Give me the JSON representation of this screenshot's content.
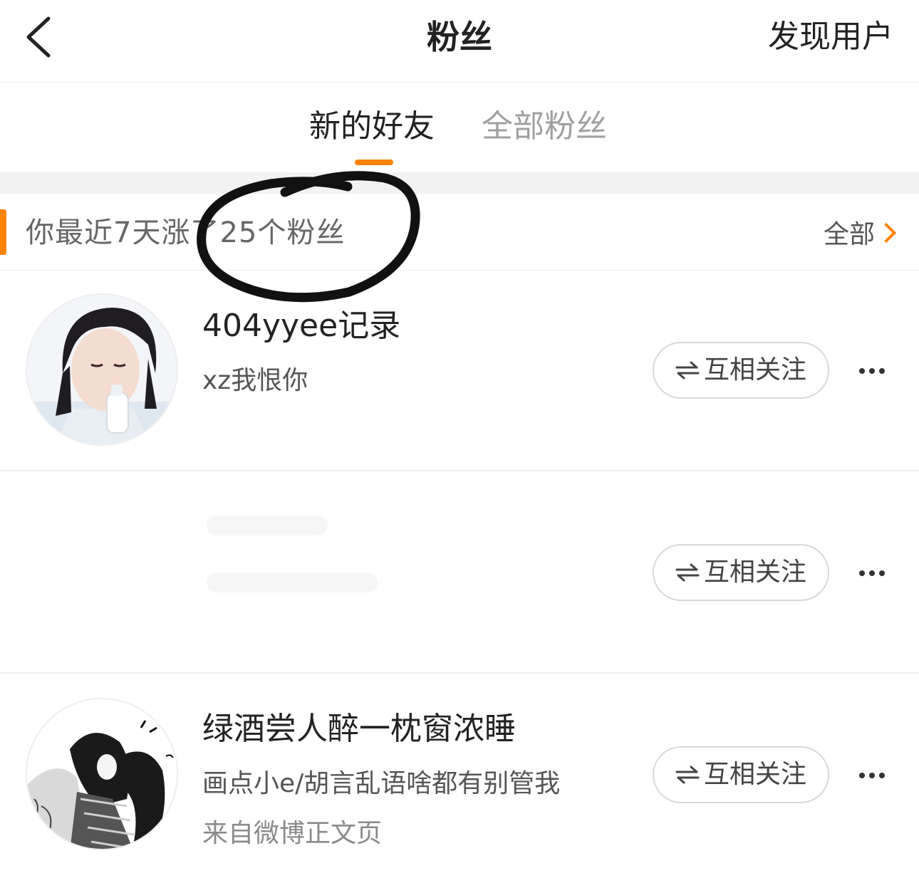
{
  "nav": {
    "title": "粉丝",
    "discover": "发现用户"
  },
  "tabs": [
    {
      "label": "新的好友",
      "active": true
    },
    {
      "label": "全部粉丝",
      "active": false
    }
  ],
  "summary": {
    "text": "你最近7天涨了25个粉丝",
    "see_all": "全部"
  },
  "users": [
    {
      "name": "404yyee记录",
      "desc": "xz我恨你",
      "source": "",
      "button": "互相关注"
    },
    {
      "name": "",
      "desc": "",
      "source": "",
      "button": "互相关注"
    },
    {
      "name": "绿酒尝人醉一枕窗浓睡",
      "desc": "画点小e/胡言乱语啥都有别管我",
      "source": "来自微博正文页",
      "button": "互相关注"
    }
  ],
  "colors": {
    "accent": "#ff8200",
    "annotation": "#111111"
  }
}
